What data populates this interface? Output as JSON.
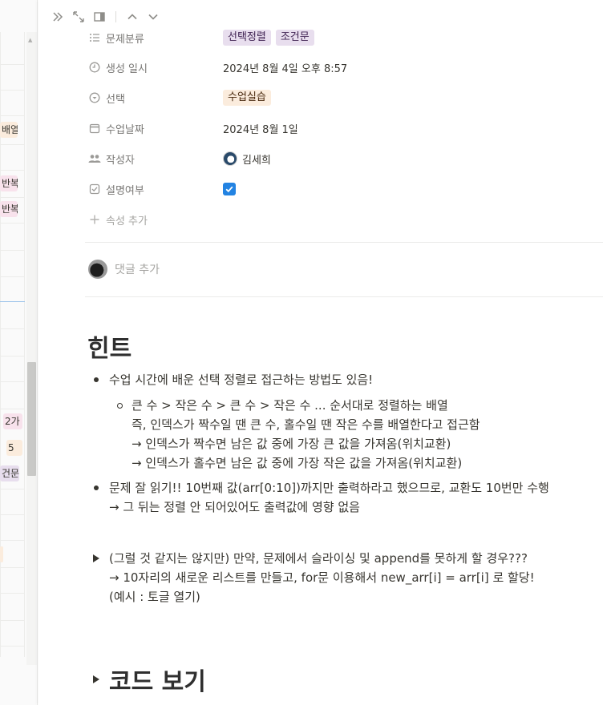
{
  "background_table": {
    "tags": [
      {
        "text": "배열",
        "color": "#fbecdd"
      },
      {
        "text": "반복",
        "color": "#f8e2ec"
      },
      {
        "text": "반복",
        "color": "#f8e2ec"
      },
      {
        "text": "2가",
        "color": "#f8e2ec"
      },
      {
        "text": "5",
        "color": "#fbecdd"
      },
      {
        "text": "건문",
        "color": "#e8deee"
      }
    ]
  },
  "toolbar": {
    "icons": [
      "double-chevron-right-icon",
      "expand-icon",
      "side-panel-icon",
      "chevron-up-icon",
      "chevron-down-icon"
    ]
  },
  "properties": [
    {
      "name": "문제분류",
      "icon": "list-icon",
      "type": "tags",
      "values": [
        {
          "text": "선택정렬",
          "style": "purple"
        },
        {
          "text": "조건문",
          "style": "purple"
        }
      ]
    },
    {
      "name": "생성 일시",
      "icon": "clock-icon",
      "type": "text",
      "value": "2024년 8월 4일 오후 8:57"
    },
    {
      "name": "선택",
      "icon": "select-icon",
      "type": "tags",
      "values": [
        {
          "text": "수업실습",
          "style": "yellow"
        }
      ]
    },
    {
      "name": "수업날짜",
      "icon": "calendar-icon",
      "type": "text",
      "value": "2024년 8월 1일"
    },
    {
      "name": "작성자",
      "icon": "people-icon",
      "type": "person",
      "value": "김세희"
    },
    {
      "name": "설명여부",
      "icon": "checkbox-icon",
      "type": "checkbox",
      "value": true
    }
  ],
  "add_property_label": "속성 추가",
  "comment": {
    "placeholder": "댓글 추가"
  },
  "content": {
    "heading": "힌트",
    "bullet1": "수업 시간에 배운 선택 정렬로 접근하는 방법도 있음!",
    "sub_bullet": {
      "line1": "큰 수 > 작은 수 > 큰 수 > 작은 수 ... 순서대로 정렬하는 배열",
      "line2": "즉, 인덱스가 짝수일 땐 큰 수, 홀수일 땐 작은 수를 배열한다고 접근함",
      "line3": "→ 인덱스가 짝수면 남은 값 중에 가장 큰 값을 가져옴(위치교환)",
      "line4": "→ 인덱스가 홀수면 남은 값 중에 가장 작은 값을 가져옴(위치교환)"
    },
    "bullet2": {
      "line1": "문제 잘 읽기!! 10번째 값(arr[0:10])까지만 출력하라고 했으므로, 교환도 10번만 수행",
      "line2": "→ 그 뒤는 정렬 안 되어있어도 출력값에 영향 없음"
    },
    "toggle1": {
      "line1": "(그럴 것 같지는 않지만) 만약, 문제에서 슬라이싱 및 append를 못하게 할 경우???",
      "line2": "→ 10자리의 새로운 리스트를 만들고, for문 이용해서 new_arr[i] = arr[i] 로 할당!",
      "line3": "(예시 : 토글 열기)"
    },
    "toggle_heading": "코드 보기"
  }
}
